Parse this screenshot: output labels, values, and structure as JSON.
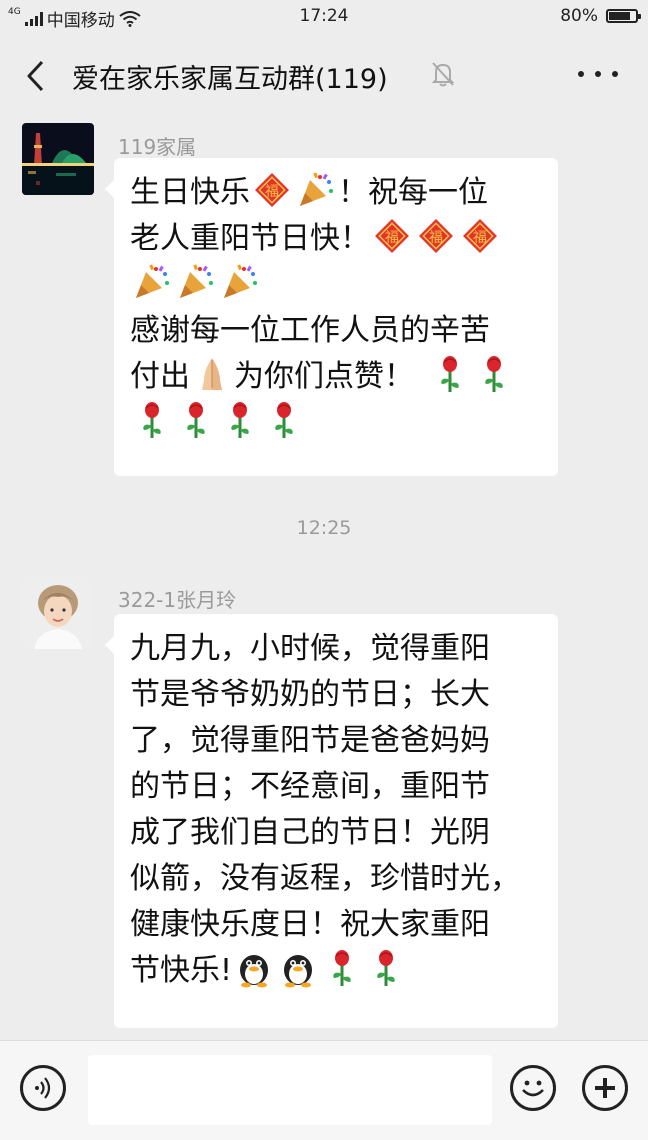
{
  "status_bar": {
    "network_tag": "4G",
    "carrier": "中国移动",
    "time": "17:24",
    "battery": "80%",
    "battery_level": 0.8
  },
  "header": {
    "title": "爱在家乐家属互动群(119)",
    "icons": [
      "back-arrow-icon",
      "mute-bell-icon",
      "more-dots-icon"
    ]
  },
  "messages": [
    {
      "sender": "119家属",
      "avatar": "night-harbor-photo",
      "text_lines": [
        "生日快乐",
        "！祝每一位",
        "老人重阳节日快！",
        "感谢每一位工作人员的辛苦",
        "付出",
        "为你们点赞！"
      ]
    },
    {
      "sender": "322-1张月玲",
      "avatar": "portrait-photo",
      "text_lines": [
        "九月九，小时候，觉得重阳",
        "节是爷爷奶奶的节日；长大",
        "了，觉得重阳节是爸爸妈妈",
        "的节日；不经意间，重阳节",
        "成了我们自己的节日！光阴",
        "似箭，没有返程，珍惜时光，",
        "健康快乐度日！祝大家重阳",
        "节快乐!"
      ]
    }
  ],
  "time_divider": "12:25",
  "emoji_names": [
    "fu-blessing-emoji",
    "party-popper-emoji",
    "praying-hands-emoji",
    "rose-emoji",
    "penguin-emoji"
  ],
  "colors": {
    "background": "#ededed",
    "bubble": "#ffffff",
    "secondary_text": "#9a9a9a"
  },
  "input_bar": {
    "icons": [
      "voice-icon",
      "emoji-face-icon",
      "plus-icon"
    ]
  }
}
